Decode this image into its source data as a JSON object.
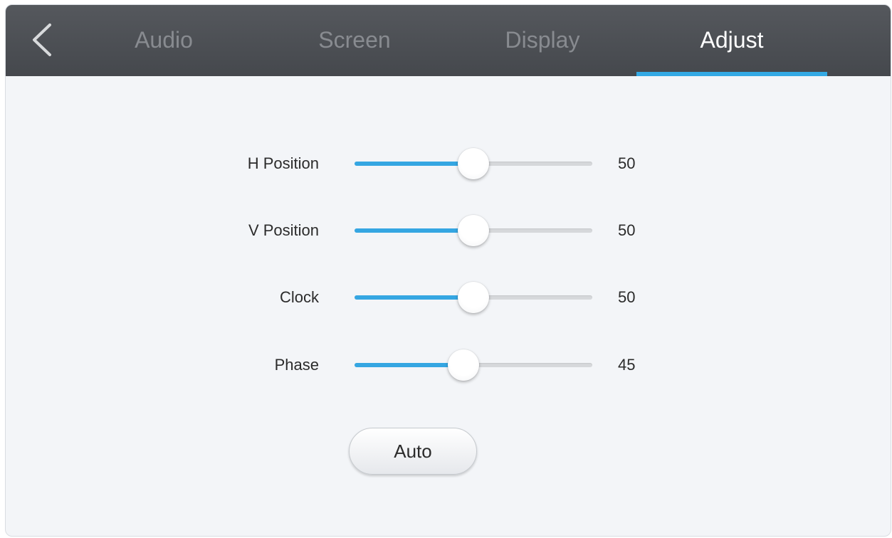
{
  "tabs": [
    {
      "label": "Audio",
      "active": false
    },
    {
      "label": "Screen",
      "active": false
    },
    {
      "label": "Display",
      "active": false
    },
    {
      "label": "Adjust",
      "active": true
    }
  ],
  "accent_color": "#33a9e4",
  "back_icon": "chevron-left-icon",
  "settings": [
    {
      "label": "H Position",
      "value": "50",
      "level": 50
    },
    {
      "label": "V Position",
      "value": "50",
      "level": 50
    },
    {
      "label": "Clock",
      "value": "50",
      "level": 50
    },
    {
      "label": "Phase",
      "value": "45",
      "level": 45
    }
  ],
  "auto_button": {
    "label": "Auto"
  }
}
